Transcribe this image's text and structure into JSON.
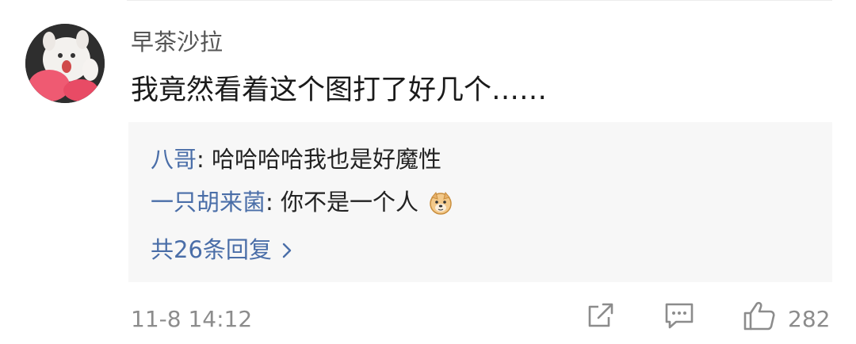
{
  "comment": {
    "username": "早茶沙拉",
    "text": "我竟然看着这个图打了好几个……",
    "avatar_icon": "cat-avatar-icon"
  },
  "replies": [
    {
      "name": "八哥",
      "text": "哈哈哈哈我也是好魔性",
      "emoji": null
    },
    {
      "name": "一只胡来菌",
      "text": "你不是一个人",
      "emoji": "doge-emoji-icon"
    }
  ],
  "more_replies": "共26条回复",
  "meta": {
    "time": "11-8 14:12",
    "likes": "282"
  },
  "icons": {
    "share": "share-icon",
    "comment": "comment-icon",
    "like": "thumbs-up-icon",
    "more": "chevron-right-icon"
  },
  "colors": {
    "link": "#4a6ea8",
    "reply_bg": "#f7f7f7",
    "muted": "#8c8c8c"
  }
}
